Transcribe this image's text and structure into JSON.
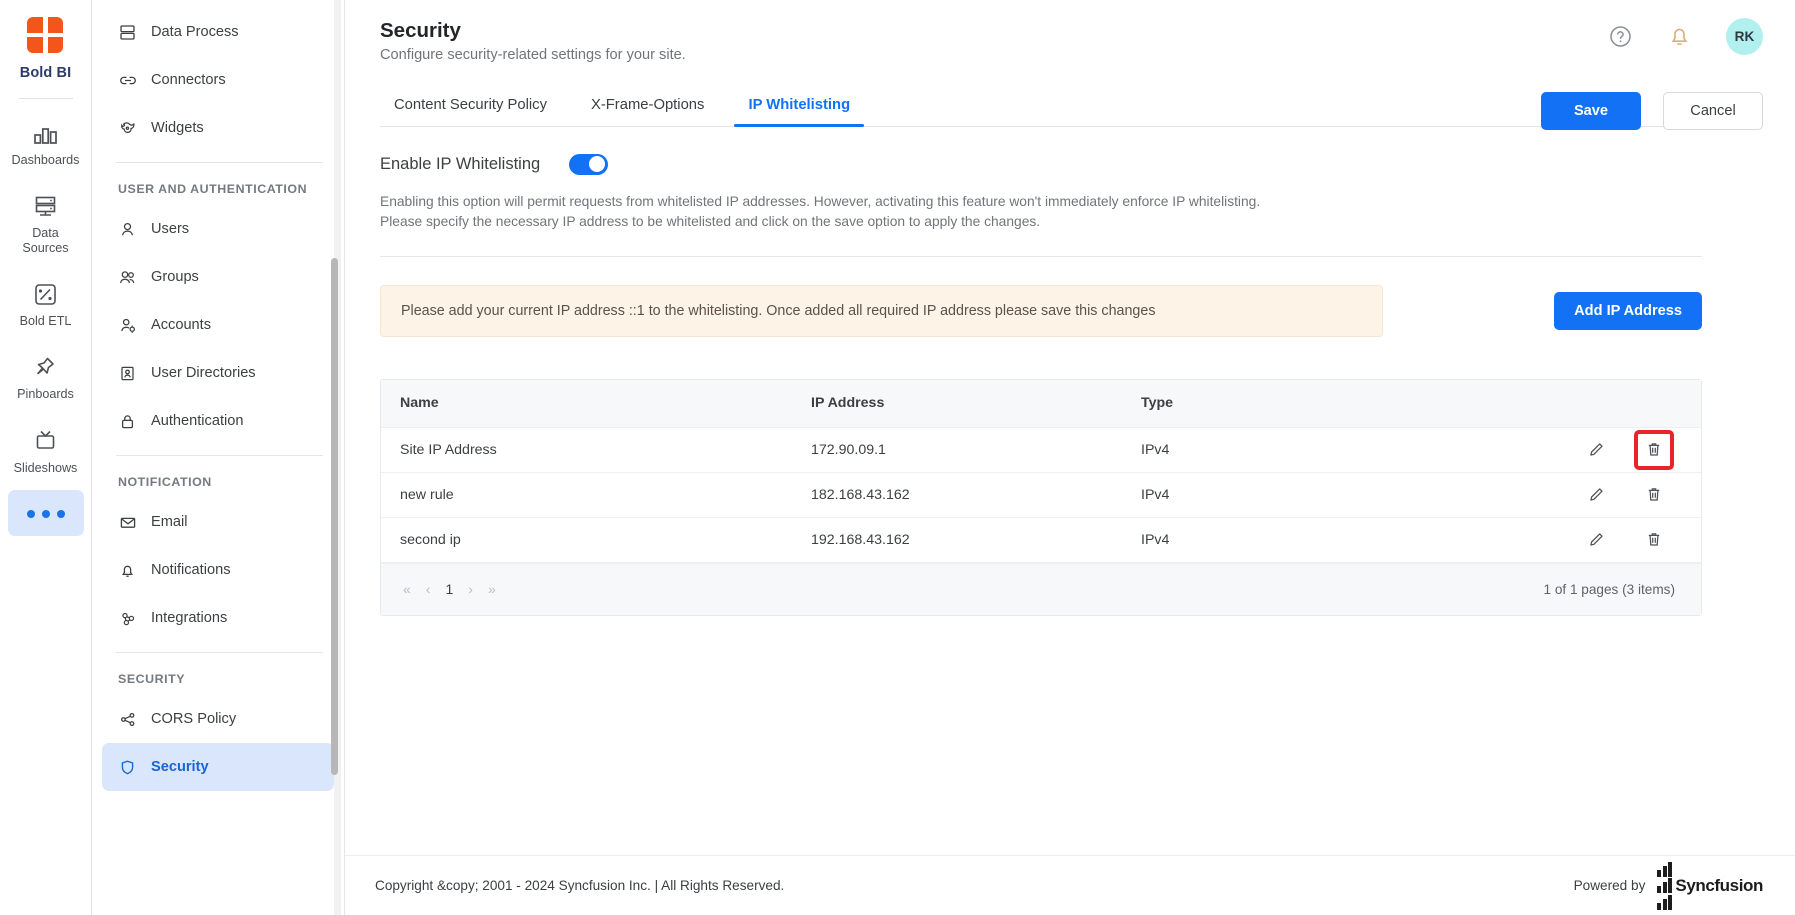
{
  "rail": {
    "brand": {
      "label": "Bold BI",
      "logo_color": "#f3561a"
    },
    "items": [
      {
        "label": "Dashboards",
        "icon": "bar-chart-icon",
        "active": false
      },
      {
        "label": "Data Sources",
        "icon": "database-icon",
        "active": false
      },
      {
        "label": "Bold ETL",
        "icon": "etl-icon",
        "active": false
      },
      {
        "label": "Pinboards",
        "icon": "pin-icon",
        "active": false
      },
      {
        "label": "Slideshows",
        "icon": "tv-icon",
        "active": false
      },
      {
        "label": "",
        "icon": "more-dots-icon",
        "active": true
      }
    ]
  },
  "nav": {
    "groups": [
      {
        "heading": null,
        "items": [
          {
            "label": "Data Process",
            "icon": "data-process-icon",
            "active": false
          },
          {
            "label": "Connectors",
            "icon": "link-icon",
            "active": false
          },
          {
            "label": "Widgets",
            "icon": "widgets-icon",
            "active": false
          }
        ]
      },
      {
        "heading": "USER AND AUTHENTICATION",
        "items": [
          {
            "label": "Users",
            "icon": "user-icon",
            "active": false
          },
          {
            "label": "Groups",
            "icon": "users-group-icon",
            "active": false
          },
          {
            "label": "Accounts",
            "icon": "user-gear-icon",
            "active": false
          },
          {
            "label": "User Directories",
            "icon": "id-card-icon",
            "active": false
          },
          {
            "label": "Authentication",
            "icon": "lock-icon",
            "active": false
          }
        ]
      },
      {
        "heading": "NOTIFICATION",
        "items": [
          {
            "label": "Email",
            "icon": "envelope-icon",
            "active": false
          },
          {
            "label": "Notifications",
            "icon": "bell-icon",
            "active": false
          },
          {
            "label": "Integrations",
            "icon": "integrations-icon",
            "active": false
          }
        ]
      },
      {
        "heading": "SECURITY",
        "items": [
          {
            "label": "CORS Policy",
            "icon": "share-nodes-icon",
            "active": false
          },
          {
            "label": "Security",
            "icon": "shield-icon",
            "active": true
          }
        ]
      }
    ]
  },
  "header": {
    "title": "Security",
    "subtitle": "Configure security-related settings for your site.",
    "help_icon": "help-circle-icon",
    "notification_icon": "bell-icon",
    "avatar_initials": "RK",
    "avatar_color": "#b2f0f0",
    "save_label": "Save",
    "cancel_label": "Cancel",
    "accent_color": "#1271f5"
  },
  "tabs": [
    {
      "label": "Content Security Policy",
      "active": false
    },
    {
      "label": "X-Frame-Options",
      "active": false
    },
    {
      "label": "IP Whitelisting",
      "active": true
    }
  ],
  "whitelisting": {
    "toggle_label": "Enable IP Whitelisting",
    "toggle_on": true,
    "description_line1": "Enabling this option will permit requests from whitelisted IP addresses. However, activating this feature won't immediately enforce IP whitelisting.",
    "description_line2": "Please specify the necessary IP address to be whitelisted and click on the save option to apply the changes.",
    "alert_text": "Please add your current IP address ::1 to the whitelisting. Once added all required IP address please save this changes",
    "alert_bg": "#fdf3e7",
    "add_button_label": "Add IP Address"
  },
  "table": {
    "columns": [
      "Name",
      "IP Address",
      "Type"
    ],
    "rows": [
      {
        "name": "Site IP Address",
        "ip": "172.90.09.1",
        "type": "IPv4",
        "edit_icon": "pencil-icon",
        "delete_icon": "trash-icon",
        "delete_highlighted": true
      },
      {
        "name": "new rule",
        "ip": "182.168.43.162",
        "type": "IPv4",
        "edit_icon": "pencil-icon",
        "delete_icon": "trash-icon",
        "delete_highlighted": false
      },
      {
        "name": "second ip",
        "ip": "192.168.43.162",
        "type": "IPv4",
        "edit_icon": "pencil-icon",
        "delete_icon": "trash-icon",
        "delete_highlighted": false
      }
    ],
    "pagination": {
      "first": "«",
      "prev": "‹",
      "current_page": "1",
      "next": "›",
      "last": "»",
      "summary": "1 of 1 pages (3 items)"
    },
    "highlight_color": "#e8232a"
  },
  "footer": {
    "copyright": "Copyright &copy; 2001 - 2024 Syncfusion Inc. | All Rights Reserved.",
    "powered_by": "Powered by",
    "brand": "Syncfusion"
  }
}
